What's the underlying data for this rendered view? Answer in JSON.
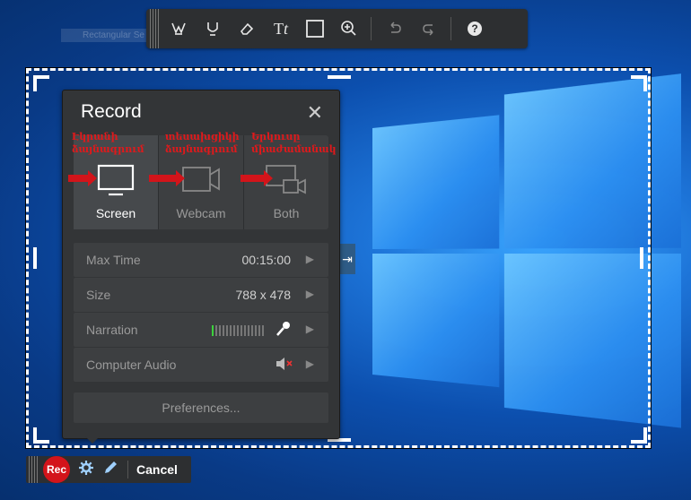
{
  "toolbar": {
    "tools": [
      {
        "name": "highlighter-icon",
        "glyph": "⩔"
      },
      {
        "name": "pen-icon",
        "glyph": "⊍"
      },
      {
        "name": "eraser-icon",
        "glyph": "⌫"
      },
      {
        "name": "text-icon",
        "glyph": "Tt"
      },
      {
        "name": "rectangle-icon",
        "glyph": "□"
      },
      {
        "name": "zoom-icon",
        "glyph": "⊕"
      },
      {
        "name": "undo-icon",
        "glyph": "↶"
      },
      {
        "name": "redo-icon",
        "glyph": "↷"
      },
      {
        "name": "help-icon",
        "glyph": "❓"
      }
    ]
  },
  "ghost_label": "Rectangular Se",
  "panel": {
    "title": "Record",
    "close_glyph": "✕",
    "modes": [
      {
        "label": "Screen",
        "active": true
      },
      {
        "label": "Webcam",
        "active": false
      },
      {
        "label": "Both",
        "active": false
      }
    ],
    "settings": [
      {
        "label": "Max Time",
        "value": "00:15:00",
        "arrow": "▶"
      },
      {
        "label": "Size",
        "value": "788 x 478",
        "arrow": "▶"
      },
      {
        "label": "Narration",
        "value": "",
        "arrow": "▶",
        "icon": "mic-icon"
      },
      {
        "label": "Computer Audio",
        "value": "",
        "arrow": "▶",
        "icon": "speaker-muted-icon"
      }
    ],
    "preferences": "Preferences..."
  },
  "annotations": [
    {
      "line1": "Էկրանի",
      "line2": "ձայնագրում"
    },
    {
      "line1": "տեսախցիկի",
      "line2": "ձայնագրում"
    },
    {
      "line1": "Երկուսը",
      "line2": "միաժամանակ"
    }
  ],
  "bottombar": {
    "rec": "Rec",
    "cancel": "Cancel"
  },
  "colors": {
    "accent_red": "#d3141a",
    "panel_bg": "#333537",
    "row_bg": "#3d3f41"
  }
}
